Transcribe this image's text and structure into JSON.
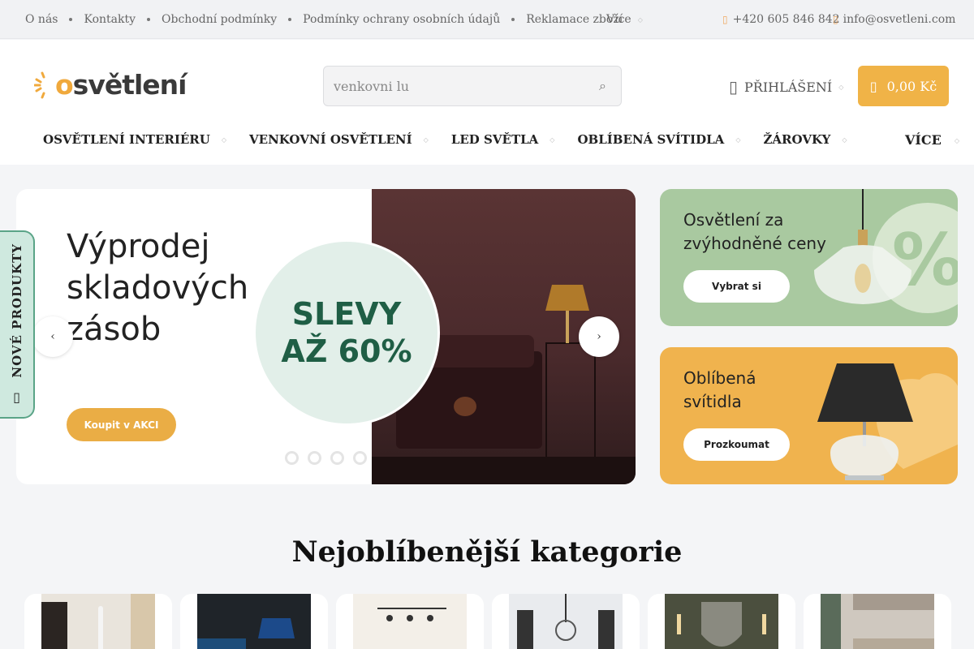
{
  "topbar": {
    "links": [
      "O nás",
      "Kontakty",
      "Obchodní podmínky",
      "Podmínky ochrany osobních údajů",
      "Reklamace zboží"
    ],
    "more_label": "Více",
    "phone": "+420 605 846 842",
    "email": "info@osvetleni.com"
  },
  "header": {
    "logo_text": "světlení",
    "logo_letter": "o",
    "search_placeholder": "venkovni lu",
    "login_label": "PŘIHLÁŠENÍ",
    "cart_total": "0,00 Kč"
  },
  "nav": {
    "items": [
      "OSVĚTLENÍ INTERIÉRU",
      "VENKOVNÍ OSVĚTLENÍ",
      "LED SVĚTLA",
      "OBLÍBENÁ SVÍTIDLA",
      "ŽÁROVKY"
    ],
    "more_label": "VÍCE"
  },
  "hero": {
    "title": "Výprodej skladových zásob",
    "badge_line1": "SLEVY",
    "badge_line2": "AŽ 60%",
    "cta_label": "Koupit v AKCI",
    "dots_count": 4
  },
  "banners": [
    {
      "title": "Osvětlení za zvýhodněné ceny",
      "button": "Vybrat si",
      "bg": "#a9c9a0",
      "symbol": "%"
    },
    {
      "title": "Oblíbená svítidla",
      "button": "Prozkoumat",
      "bg": "#f0b34e"
    }
  ],
  "sidebar_tab": {
    "label": "NOVÉ PRODUKTY"
  },
  "categories": {
    "title": "Nejoblíbenější kategorie",
    "count": 6
  },
  "colors": {
    "accent": "#f0b347",
    "green": "#5aa487",
    "badge_text": "#1f5e45"
  }
}
